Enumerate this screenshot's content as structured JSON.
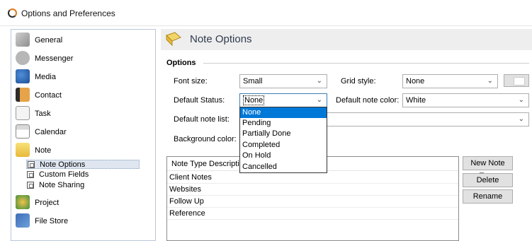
{
  "window": {
    "title": "Options and Preferences"
  },
  "sidebar": {
    "items": [
      {
        "label": "General",
        "icon": "wrench-icon"
      },
      {
        "label": "Messenger",
        "icon": "chat-bubble-icon"
      },
      {
        "label": "Media",
        "icon": "media-person-icon"
      },
      {
        "label": "Contact",
        "icon": "contact-book-icon"
      },
      {
        "label": "Task",
        "icon": "task-pencil-icon"
      },
      {
        "label": "Calendar",
        "icon": "calendar-icon"
      },
      {
        "label": "Note",
        "icon": "note-pad-icon"
      }
    ],
    "note_subitems": [
      {
        "label": "Note Options"
      },
      {
        "label": "Custom Fields"
      },
      {
        "label": "Note Sharing"
      }
    ],
    "bottom_items": [
      {
        "label": "Project",
        "icon": "project-globe-icon"
      },
      {
        "label": "File Store",
        "icon": "file-store-icon"
      }
    ]
  },
  "content": {
    "title": "Note Options",
    "section": "Options",
    "font_size": {
      "label": "Font size:",
      "value": "Small"
    },
    "grid_style": {
      "label": "Grid style:",
      "value": "None"
    },
    "default_status": {
      "label": "Default Status:",
      "value": "None"
    },
    "default_note_color": {
      "label": "Default note color:",
      "value": "White"
    },
    "default_note_list": {
      "label": "Default note list:",
      "value": ""
    },
    "background_color": {
      "label": "Background color:"
    },
    "table": {
      "header": "Note Type Description",
      "rows": [
        "Client Notes",
        "Websites",
        "Follow Up",
        "Reference"
      ]
    },
    "buttons": {
      "new_type": "New Note Type",
      "delete": "Delete",
      "rename": "Rename"
    },
    "status_options": [
      "None",
      "Pending",
      "Partially Done",
      "Completed",
      "On Hold",
      "Cancelled"
    ]
  },
  "colors": {
    "accent": "#0078d7",
    "sidebar_border": "#b9c7d9",
    "header_band": "#eeeeee"
  }
}
